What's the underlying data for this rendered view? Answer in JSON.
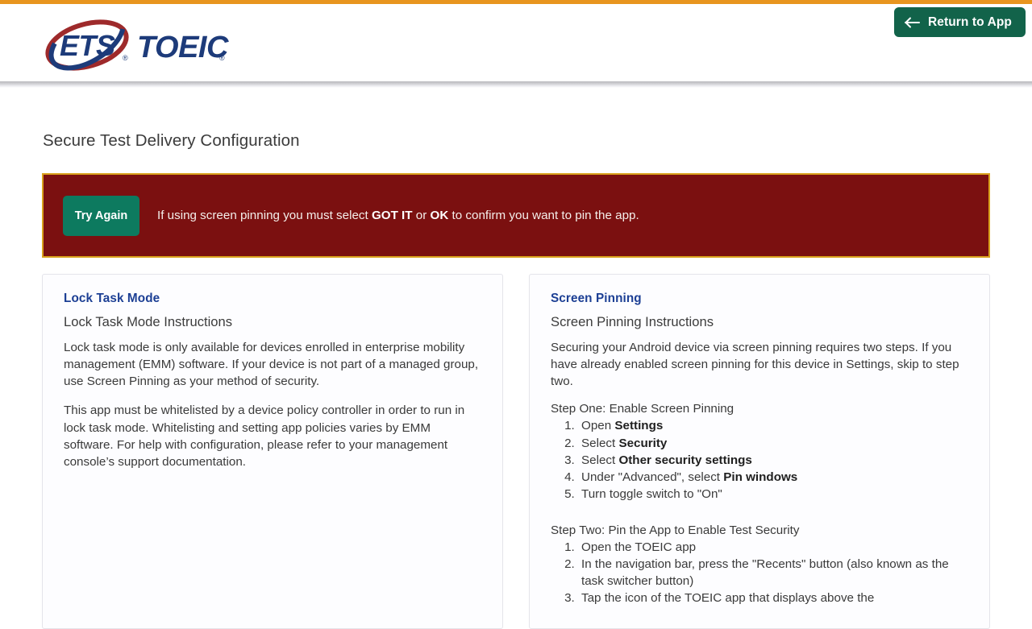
{
  "header": {
    "logo_alt": "ETS TOEIC",
    "logo_primary": "ETS",
    "logo_secondary": "TOEIC",
    "return_button_label": "Return to App",
    "return_button_icon": "arrow-left-icon",
    "accent_color": "#e8951f",
    "return_button_color": "#12634a"
  },
  "main": {
    "page_title": "Secure Test Delivery Configuration"
  },
  "alert": {
    "button_label": "Try Again",
    "message_part1": "If using screen pinning you must select ",
    "message_bold1": "GOT IT",
    "message_part2": " or ",
    "message_bold2": "OK",
    "message_part3": " to confirm you want to pin the app.",
    "background_color": "#7b1010",
    "border_color": "#d9a11c",
    "button_color": "#0d7a5f"
  },
  "cards": {
    "lock_task_mode": {
      "title": "Lock Task Mode",
      "subtitle": "Lock Task Mode Instructions",
      "paragraph1": "Lock task mode is only available for devices enrolled in enterprise mobility management (EMM) software. If your device is not part of a managed group, use Screen Pinning as your method of security.",
      "paragraph2": "This app must be whitelisted by a device policy controller in order to run in lock task mode. Whitelisting and setting app policies varies by EMM software. For help with configuration, please refer to your management console’s support documentation."
    },
    "screen_pinning": {
      "title": "Screen Pinning",
      "subtitle": "Screen Pinning Instructions",
      "paragraph1": "Securing your Android device via screen pinning requires two steps. If you have already enabled screen pinning for this device in Settings, skip to step two.",
      "step_one_heading": "Step One: Enable Screen Pinning",
      "step_one_items": [
        {
          "prefix": "Open ",
          "bold": "Settings",
          "suffix": ""
        },
        {
          "prefix": "Select ",
          "bold": "Security",
          "suffix": ""
        },
        {
          "prefix": "Select ",
          "bold": "Other security settings",
          "suffix": ""
        },
        {
          "prefix": "Under \"Advanced\", select ",
          "bold": "Pin windows",
          "suffix": ""
        },
        {
          "prefix": "Turn toggle switch to \"On\"",
          "bold": "",
          "suffix": ""
        }
      ],
      "step_two_heading": "Step Two: Pin the App to Enable Test Security",
      "step_two_items": [
        {
          "prefix": "Open the TOEIC app",
          "bold": "",
          "suffix": ""
        },
        {
          "prefix": "In the navigation bar, press the \"Recents\" button (also known as the task switcher button)",
          "bold": "",
          "suffix": ""
        },
        {
          "prefix": "Tap the icon of the TOEIC app that displays above the",
          "bold": "",
          "suffix": ""
        }
      ]
    }
  },
  "colors": {
    "heading_blue": "#1c3f94",
    "page_background": "#ffffff",
    "card_border": "#e4e4ea"
  }
}
